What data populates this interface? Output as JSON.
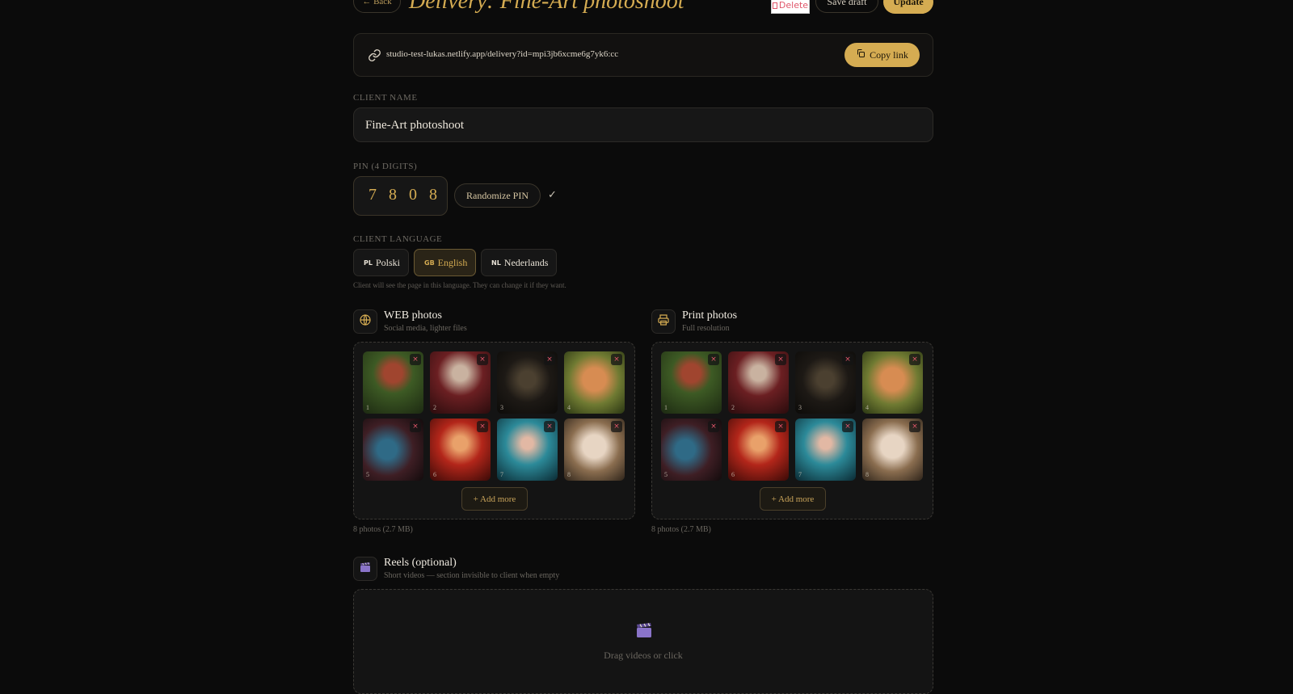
{
  "header": {
    "back_label": "← Back",
    "title": "Delivery: Fine-Art photoshoot",
    "delete_label": "Delete",
    "save_draft_label": "Save draft",
    "update_label": "Update"
  },
  "link": {
    "url": "studio-test-lukas.netlify.app/delivery?id=mpi3jb6xcme6g7yk6:cc",
    "copy_label": "Copy link"
  },
  "client_name": {
    "label": "CLIENT NAME",
    "value": "Fine-Art photoshoot"
  },
  "pin": {
    "label": "PIN (4 DIGITS)",
    "value": "7 8 0 8",
    "randomize_label": "Randomize PIN",
    "status": "✓"
  },
  "language": {
    "label": "CLIENT LANGUAGE",
    "options": [
      {
        "code": "PL",
        "label": "Polski",
        "selected": false
      },
      {
        "code": "GB",
        "label": "English",
        "selected": true
      },
      {
        "code": "NL",
        "label": "Nederlands",
        "selected": false
      }
    ],
    "hint": "Client will see the page in this language. They can change it if they want."
  },
  "web_photos": {
    "title": "WEB photos",
    "subtitle": "Social media, lighter files",
    "add_more_label": "+ Add more",
    "count": "8 photos (2.7 MB)",
    "thumbs": [
      "1",
      "2",
      "3",
      "4",
      "5",
      "6",
      "7",
      "8"
    ]
  },
  "print_photos": {
    "title": "Print photos",
    "subtitle": "Full resolution",
    "add_more_label": "+ Add more",
    "count": "8 photos (2.7 MB)",
    "thumbs": [
      "1",
      "2",
      "3",
      "4",
      "5",
      "6",
      "7",
      "8"
    ]
  },
  "reels": {
    "title": "Reels (optional)",
    "subtitle": "Short videos — section invisible to client when empty",
    "drop_label": "Drag videos or click",
    "icon": "clapper-board-icon"
  },
  "colors": {
    "background": "#0b0b0b",
    "accent_gold": "#d5ac52",
    "delete_red": "#e0566a",
    "panel": "#121212",
    "border": "#2c2a27"
  }
}
